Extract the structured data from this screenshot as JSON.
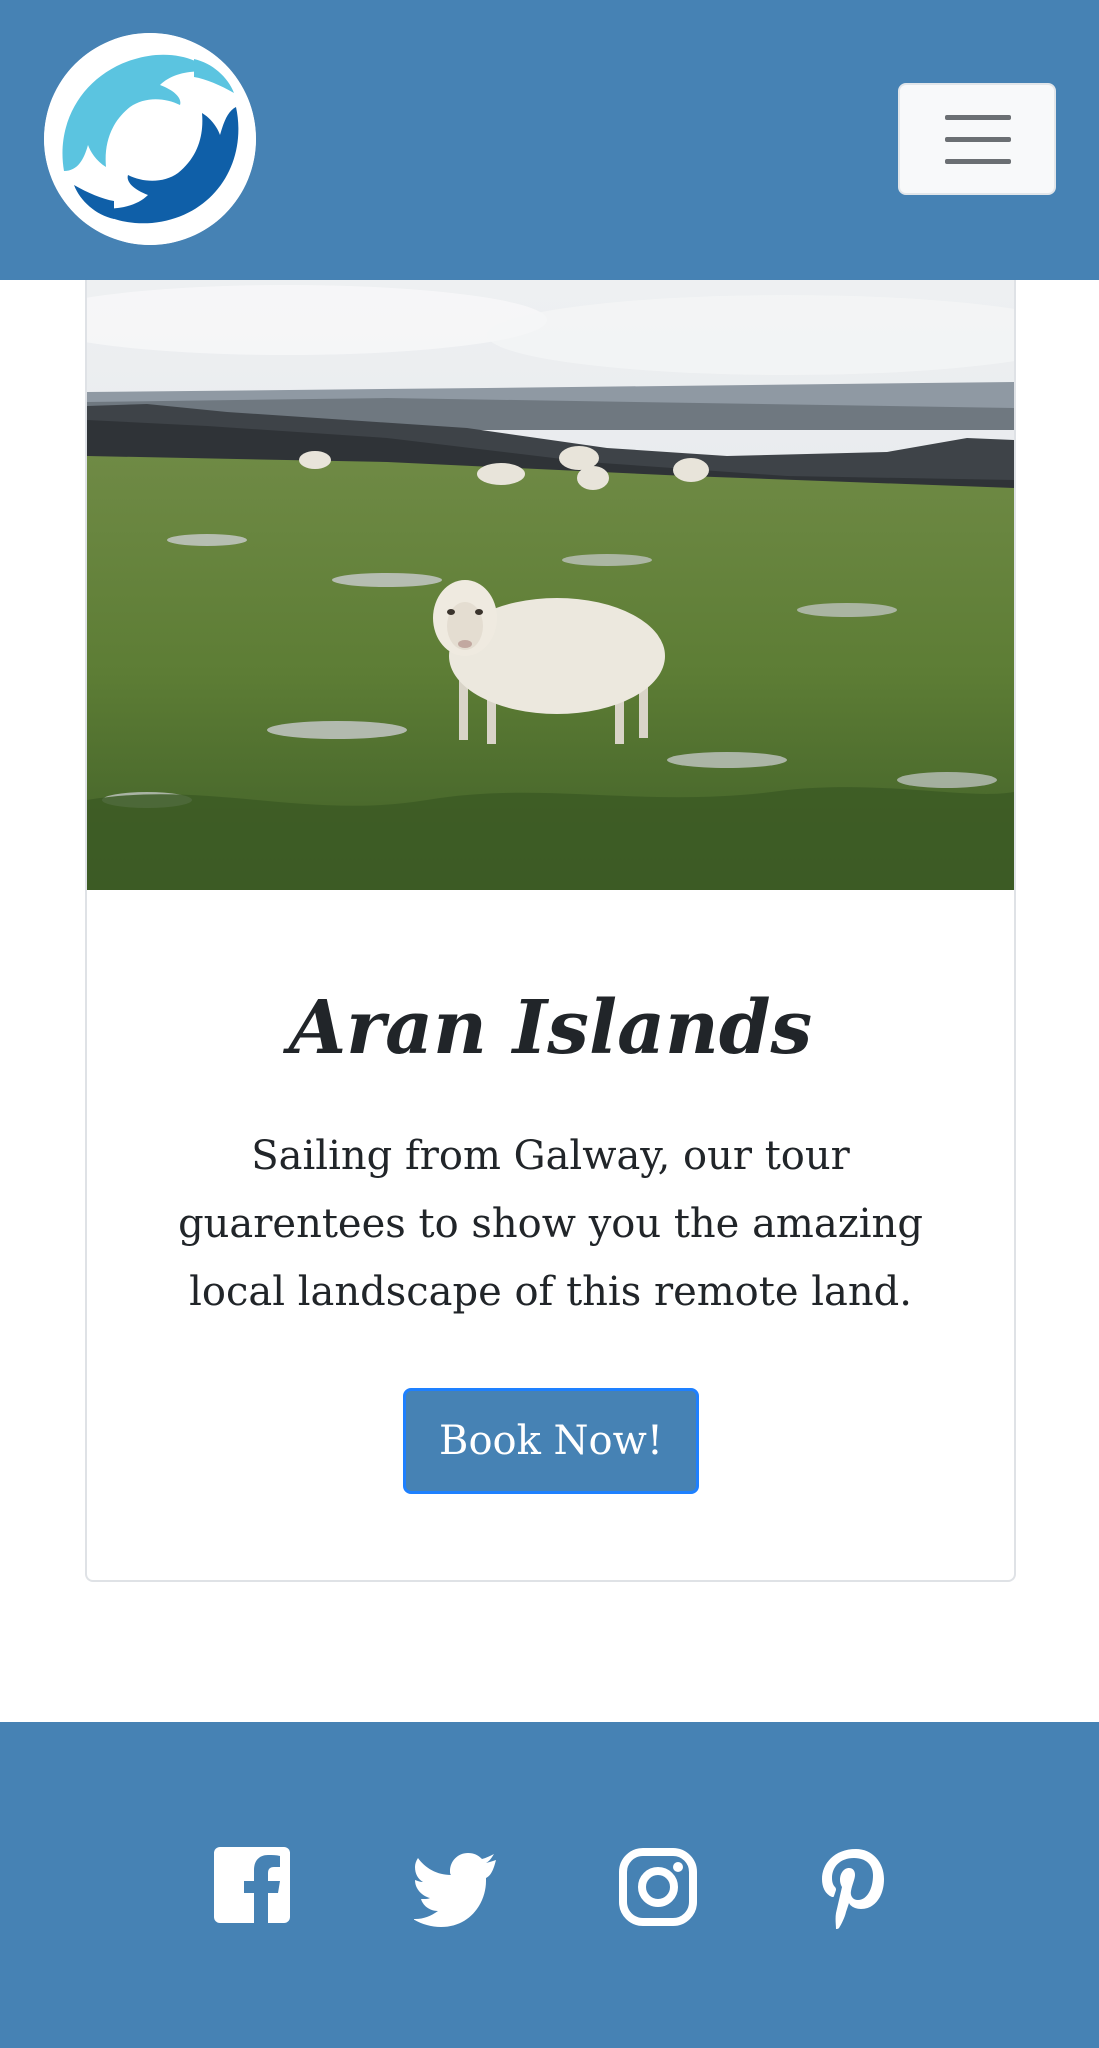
{
  "header": {
    "logo": {
      "icon": "dolphins-logo-icon",
      "colors": [
        "#5bc4e0",
        "#0f5fa8"
      ]
    },
    "menu_toggle": {
      "icon": "hamburger-menu-icon"
    }
  },
  "card": {
    "image": {
      "subject": "sheep-field-photo"
    },
    "title": "Aran Islands",
    "text": "Sailing from Galway, our tour guarentees to show you the amazing local landscape of this remote land.",
    "button_label": "Book Now!"
  },
  "footer": {
    "social": [
      {
        "icon": "facebook-icon"
      },
      {
        "icon": "twitter-icon"
      },
      {
        "icon": "instagram-icon"
      },
      {
        "icon": "pinterest-icon"
      }
    ]
  },
  "colors": {
    "brand": "#4682b4",
    "button_border": "#1e80ff",
    "text": "#212529"
  }
}
